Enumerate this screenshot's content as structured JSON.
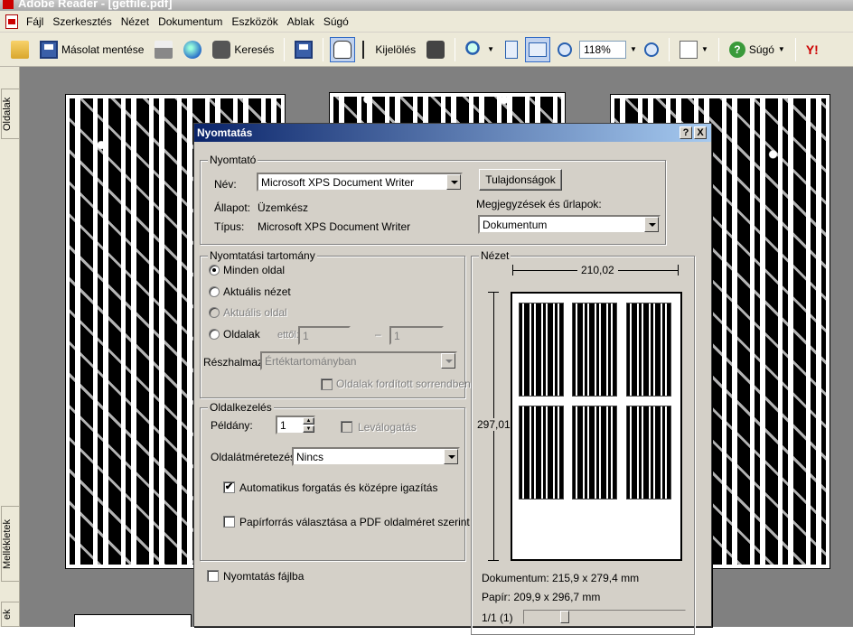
{
  "app": {
    "title": "Adobe Reader - [getfile.pdf]"
  },
  "menu": [
    "Fájl",
    "Szerkesztés",
    "Nézet",
    "Dokumentum",
    "Eszközök",
    "Ablak",
    "Súgó"
  ],
  "toolbar": {
    "save_copy": "Másolat mentése",
    "search": "Keresés",
    "select": "Kijelölés",
    "zoom": "118%",
    "help": "Súgó",
    "yahoo": "Y!"
  },
  "sidepanel": {
    "pages_tab": "Oldalak",
    "attachments_tab": "Mellékletek",
    "bottom_tab": "ek"
  },
  "dialog": {
    "title": "Nyomtatás",
    "help_btn": "?",
    "close_btn": "X",
    "printer": {
      "legend": "Nyomtató",
      "name_label": "Név:",
      "name_value": "Microsoft XPS Document Writer",
      "status_label": "Állapot:",
      "status_value": "Üzemkész",
      "type_label": "Típus:",
      "type_value": "Microsoft XPS Document Writer",
      "properties_btn": "Tulajdonságok",
      "comments_label": "Megjegyzések és űrlapok:",
      "comments_value": "Dokumentum"
    },
    "range": {
      "legend": "Nyomtatási tartomány",
      "all_pages": "Minden oldal",
      "current_view": "Aktuális nézet",
      "current_page": "Aktuális oldal",
      "pages": "Oldalak",
      "from_label": "ettől:",
      "from_value": "1",
      "dash": "–",
      "to_value": "1",
      "subset_label": "Részhalmaz:",
      "subset_value": "Értéktartományban",
      "reverse_label": "Oldalak fordított sorrendben"
    },
    "handling": {
      "legend": "Oldalkezelés",
      "copies_label": "Példány:",
      "copies_value": "1",
      "collate_label": "Leválogatás",
      "scaling_label": "Oldalátméretezés:",
      "scaling_value": "Nincs",
      "autorotate_label": "Automatikus forgatás és középre igazítás",
      "autorotate_mark": "✔",
      "paper_source_label": "Papírforrás választása a PDF oldalméret szerint"
    },
    "print_to_file": "Nyomtatás fájlba",
    "preview": {
      "legend": "Nézet",
      "width": "210,02",
      "height": "297,01",
      "document_size": "Dokumentum: 215,9 x 279,4 mm",
      "paper_size": "Papír: 209,9 x 296,7 mm",
      "page_counter": "1/1 (1)"
    }
  }
}
